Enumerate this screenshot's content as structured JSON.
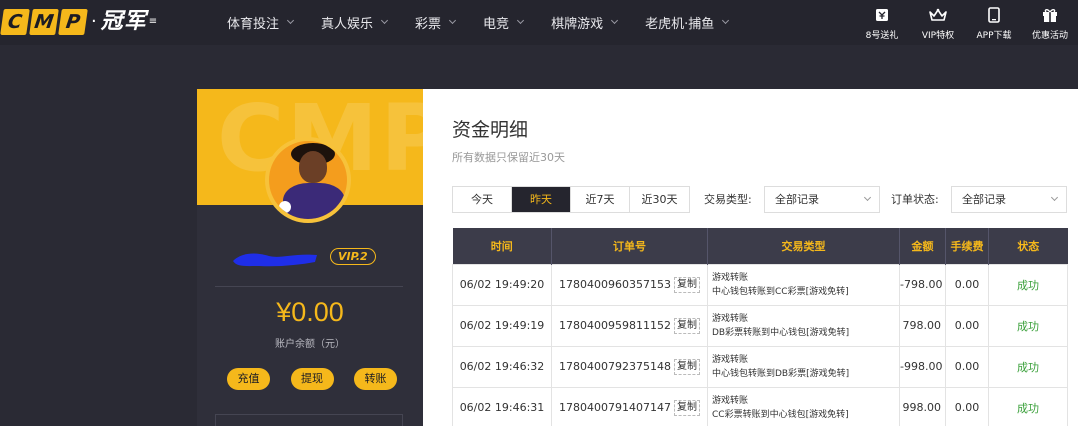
{
  "logo": {
    "box_letters": [
      "C",
      "M",
      "P"
    ],
    "dot": "·",
    "cn": "冠军",
    "tail": "≡"
  },
  "nav": {
    "items": [
      "体育投注",
      "真人娱乐",
      "彩票",
      "电竞",
      "棋牌游戏",
      "老虎机·捕鱼"
    ]
  },
  "quick_links": [
    {
      "label": "8号送礼",
      "icon": "gift-card-icon"
    },
    {
      "label": "VIP特权",
      "icon": "crown-icon"
    },
    {
      "label": "APP下载",
      "icon": "phone-icon"
    },
    {
      "label": "优惠活动",
      "icon": "gift-box-icon"
    }
  ],
  "profile": {
    "banner_text": "CMP",
    "vip": "VIP.2",
    "balance": "¥0.00",
    "balance_label": "账户余额（元）",
    "actions": [
      "充值",
      "提现",
      "转账"
    ]
  },
  "main": {
    "title": "资金明细",
    "subtitle": "所有数据只保留近30天",
    "date_tabs": [
      "今天",
      "昨天",
      "近7天",
      "近30天"
    ],
    "active_tab": 1,
    "tx_type_label": "交易类型:",
    "tx_type_value": "全部记录",
    "order_status_label": "订单状态:",
    "order_status_value": "全部记录"
  },
  "table": {
    "headers": [
      "时间",
      "订单号",
      "交易类型",
      "金额",
      "手续费",
      "状态"
    ],
    "copy_label": "复制",
    "rows": [
      {
        "time": "06/02 19:49:20",
        "order": "1780400960357153",
        "type_title": "游戏转账",
        "type_detail": "中心钱包转账到CC彩票[游戏免转]",
        "amount": "-798.00",
        "fee": "0.00",
        "status": "成功"
      },
      {
        "time": "06/02 19:49:19",
        "order": "1780400959811152",
        "type_title": "游戏转账",
        "type_detail": "DB彩票转账到中心钱包[游戏免转]",
        "amount": "798.00",
        "fee": "0.00",
        "status": "成功"
      },
      {
        "time": "06/02 19:46:32",
        "order": "1780400792375148",
        "type_title": "游戏转账",
        "type_detail": "中心钱包转账到DB彩票[游戏免转]",
        "amount": "-998.00",
        "fee": "0.00",
        "status": "成功"
      },
      {
        "time": "06/02 19:46:31",
        "order": "1780400791407147",
        "type_title": "游戏转账",
        "type_detail": "CC彩票转账到中心钱包[游戏免转]",
        "amount": "998.00",
        "fee": "0.00",
        "status": "成功"
      }
    ]
  },
  "colors": {
    "accent": "#f5b81b",
    "dark": "#25252e",
    "success": "#3aa03a"
  }
}
